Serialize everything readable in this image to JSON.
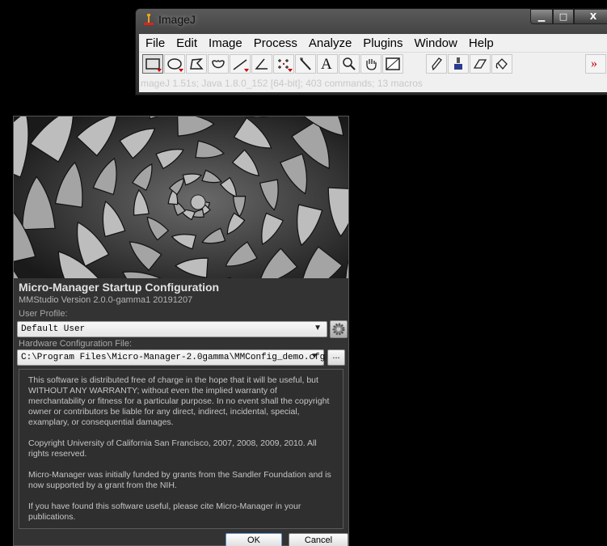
{
  "imagej": {
    "title": "ImageJ",
    "window_controls": {
      "minimize": "▁",
      "maximize": "□",
      "close": "X"
    },
    "menu": [
      "File",
      "Edit",
      "Image",
      "Process",
      "Analyze",
      "Plugins",
      "Window",
      "Help"
    ],
    "tools": [
      "rectangle-selection-icon",
      "oval-selection-icon",
      "polygon-selection-icon",
      "freehand-selection-icon",
      "line-selection-icon",
      "angle-tool-icon",
      "multi-point-tool-icon",
      "wand-tool-icon",
      "text-tool-icon",
      "magnifier-icon",
      "scroll-hand-icon",
      "color-picker-icon",
      "pencil-icon",
      "brush-icon",
      "eraser-icon",
      "flood-fill-icon",
      "more-tools-icon"
    ],
    "text_tool_label": "A",
    "more_tools_label": "»",
    "status": "mageJ 1.51s; Java 1.8.0_152 [64-bit]; 403 commands; 13 macros"
  },
  "mm": {
    "title": "Micro-Manager Startup Configuration",
    "version": "MMStudio Version 2.0.0-gamma1 20191207",
    "user_profile_label": "User Profile:",
    "user_profile_value": "Default User",
    "hw_config_label": "Hardware Configuration File:",
    "hw_config_value": "C:\\Program Files\\Micro-Manager-2.0gamma\\MMConfig_demo.cfg",
    "browse_label": "...",
    "license": [
      "This software is distributed free of charge in the hope that it will be useful, but WITHOUT ANY WARRANTY; without even the implied warranty of merchantability or fitness for a particular purpose. In no event shall the copyright owner or contributors be liable for any direct, indirect, incidental, special, examplary, or consequential damages.",
      "Copyright University of California San Francisco, 2007, 2008, 2009, 2010. All rights reserved.",
      "Micro-Manager was initially funded by grants from the Sandler Foundation and is now supported by a grant from the NIH.",
      "If you have found this software useful, please cite Micro-Manager in your publications."
    ],
    "ok_label": "OK",
    "cancel_label": "Cancel"
  }
}
